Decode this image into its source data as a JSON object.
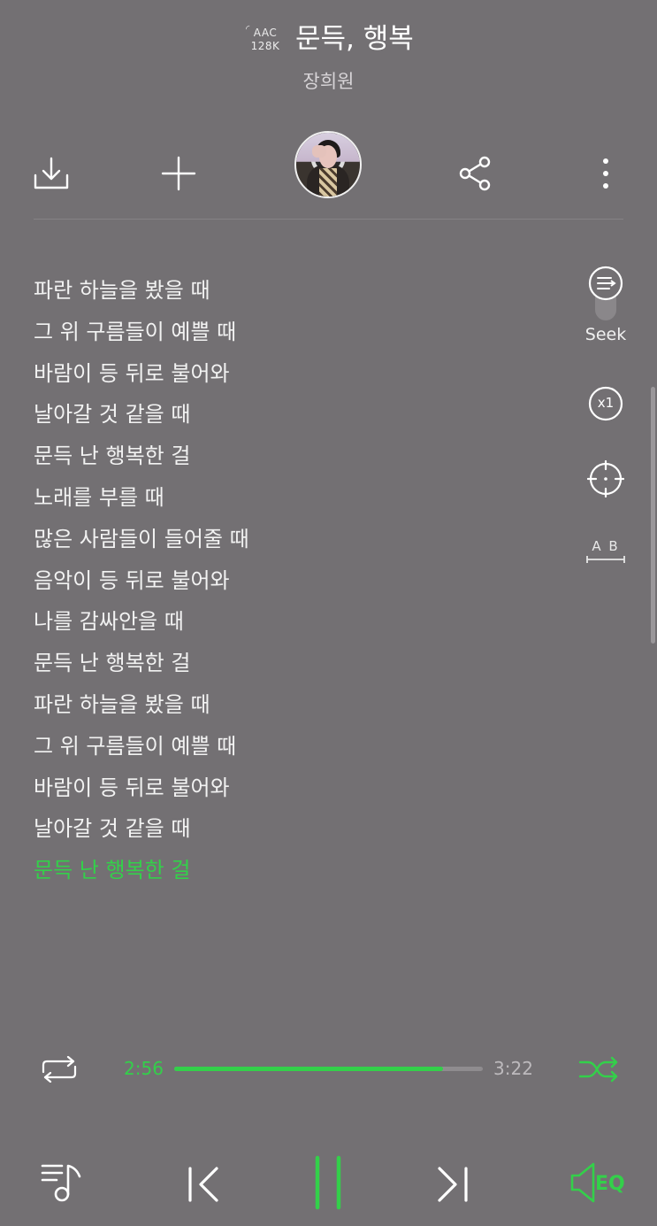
{
  "header": {
    "codec_line1": "AAC",
    "codec_line2": "128K",
    "title": "문득, 행복",
    "artist": "장희원"
  },
  "toolbar": {
    "download_icon": "download-icon",
    "add_icon": "plus-icon",
    "share_icon": "share-icon",
    "more_icon": "more-vertical-icon"
  },
  "lyrics": {
    "lines": [
      "파란 하늘을 봤을 때",
      "그 위 구름들이 예쁠 때",
      "바람이 등 뒤로 불어와",
      "날아갈 것 같을 때",
      "문득 난 행복한 걸",
      "노래를 부를 때",
      "많은 사람들이 들어줄 때",
      "음악이 등 뒤로 불어와",
      "나를 감싸안을 때",
      "문득 난 행복한 걸",
      "파란 하늘을 봤을 때",
      "그 위 구름들이 예쁠 때",
      "바람이 등 뒤로 불어와",
      "날아갈 것 같을 때",
      "문득 난 행복한 걸"
    ],
    "current_index": 14,
    "highlight_color": "#33d04a"
  },
  "side_tools": {
    "seek_label": "Seek",
    "speed_label": "x1",
    "ab_label": "A B"
  },
  "progress": {
    "current": "2:56",
    "total": "3:22",
    "fraction": 0.871
  },
  "controls": {
    "playlist_icon": "playlist-music-icon",
    "prev_icon": "previous-icon",
    "pause_icon": "pause-icon",
    "next_icon": "next-icon",
    "eq_label": "EQ",
    "accent_color": "#33d04a"
  }
}
